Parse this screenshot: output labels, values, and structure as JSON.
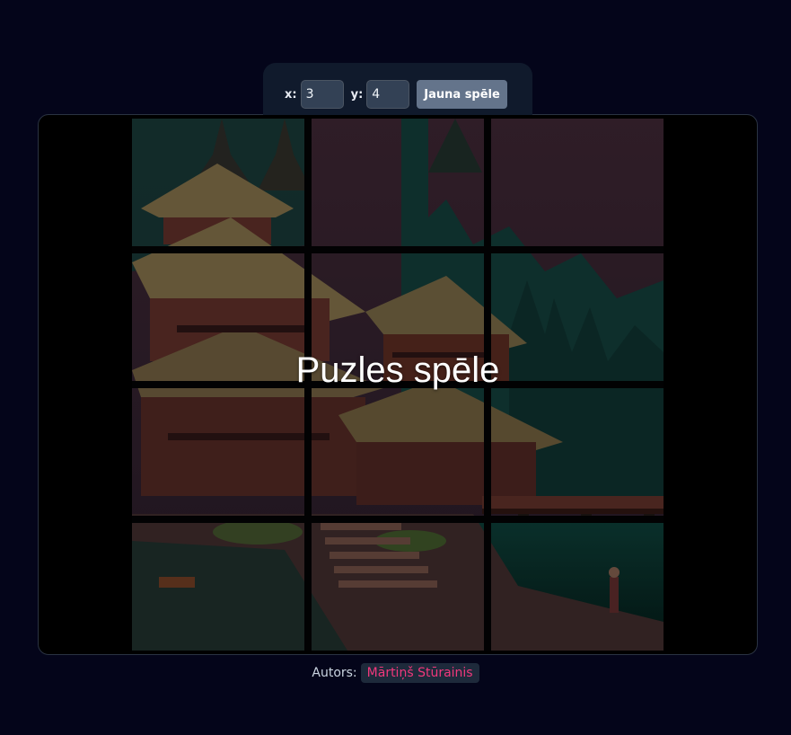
{
  "controls": {
    "x_label": "x:",
    "x_value": "3",
    "y_label": "y:",
    "y_value": "4",
    "new_game_label": "Jauna spēle"
  },
  "game": {
    "title": "Puzles spēle",
    "columns": 3,
    "rows": 4,
    "image_alt": "pagoda-temple-landscape",
    "colors": {
      "sky": "#3a2430",
      "forest": "#0f3a34",
      "roof": "#7a6a45",
      "wall": "#5a2c26",
      "water": "#0c3a34"
    }
  },
  "footer": {
    "author_label": "Autors:",
    "author_name": "Mārtiņš Stūrainis"
  }
}
